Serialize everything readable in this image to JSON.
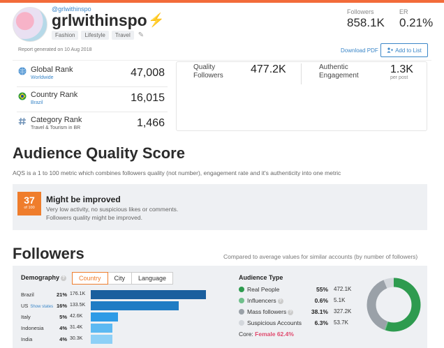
{
  "profile": {
    "handle": "@grlwithinspo",
    "username": "grlwithinspo",
    "verified_icon": "lightning-bolt-icon",
    "tags": [
      "Fashion",
      "Lifestyle",
      "Travel"
    ],
    "edit_icon": "pencil-icon"
  },
  "stats": {
    "followers_label": "Followers",
    "followers_value": "858.1K",
    "er_label": "ER",
    "er_value": "0.21%"
  },
  "report": {
    "generated": "Report generated on 10 Aug 2018",
    "download_label": "Download PDF",
    "add_label": "Add to List",
    "add_icon": "user-plus-icon"
  },
  "ranks": [
    {
      "title": "Global Rank",
      "sub": "Worldwide",
      "value": "47,008",
      "icon": "globe-icon"
    },
    {
      "title": "Country Rank",
      "sub": "Brazil",
      "value": "16,015",
      "icon": "brazil-flag-icon"
    },
    {
      "title": "Category Rank",
      "sub": "Travel & Tourism in BR",
      "value": "1,466",
      "icon": "hash-icon"
    }
  ],
  "quality": {
    "followers_label_1": "Quality",
    "followers_label_2": "Followers",
    "followers_value": "477.2K",
    "engagement_label_1": "Authentic",
    "engagement_label_2": "Engagement",
    "engagement_value": "1.3K",
    "engagement_unit": "per post"
  },
  "aqs": {
    "heading": "Audience Quality Score",
    "description": "AQS is a 1 to 100 metric which combines followers quality (not number), engagement rate and it's authenticity into one metric",
    "score": "37",
    "score_of": "of 100",
    "verdict": "Might be improved",
    "line1": "Very low activity, no suspicious likes or comments.",
    "line2": "Followers quality might be improved.",
    "badge_color": "#ef7d2c"
  },
  "followers": {
    "heading": "Followers",
    "compare_note": "Compared to average values for similar accounts (by number of followers)",
    "demography_label": "Demography",
    "tabs": [
      "Country",
      "City",
      "Language"
    ],
    "active_tab": "Country",
    "show_states": "Show states",
    "countries": [
      {
        "name": "Brazil",
        "pct": "21%",
        "count": "176.1K",
        "share": 21,
        "color": "#1a5f9e"
      },
      {
        "name": "US",
        "pct": "16%",
        "count": "133.5K",
        "share": 16,
        "color": "#1f7cc4"
      },
      {
        "name": "Italy",
        "pct": "5%",
        "count": "42.6K",
        "share": 5,
        "color": "#2e9be6"
      },
      {
        "name": "Indonesia",
        "pct": "4%",
        "count": "31.4K",
        "share": 4,
        "color": "#5cb9f2"
      },
      {
        "name": "India",
        "pct": "4%",
        "count": "30.3K",
        "share": 4,
        "color": "#8dd0f7"
      }
    ],
    "audience_type_label": "Audience Type",
    "audience": [
      {
        "label": "Real People",
        "pct": "55%",
        "count": "472.1K",
        "share": 55,
        "color": "#2e9b4f",
        "help": false
      },
      {
        "label": "Influencers",
        "pct": "0.6%",
        "count": "5.1K",
        "share": 0.6,
        "color": "#6fc08b",
        "help": true
      },
      {
        "label": "Mass followers",
        "pct": "38.1%",
        "count": "327.2K",
        "share": 38.1,
        "color": "#9aa1a8",
        "help": true
      },
      {
        "label": "Suspicious Accounts",
        "pct": "6.3%",
        "count": "53.7K",
        "share": 6.3,
        "color": "#d3d7dc",
        "help": false
      }
    ],
    "core_label": "Core:",
    "core_value": "Female 62.4%"
  }
}
